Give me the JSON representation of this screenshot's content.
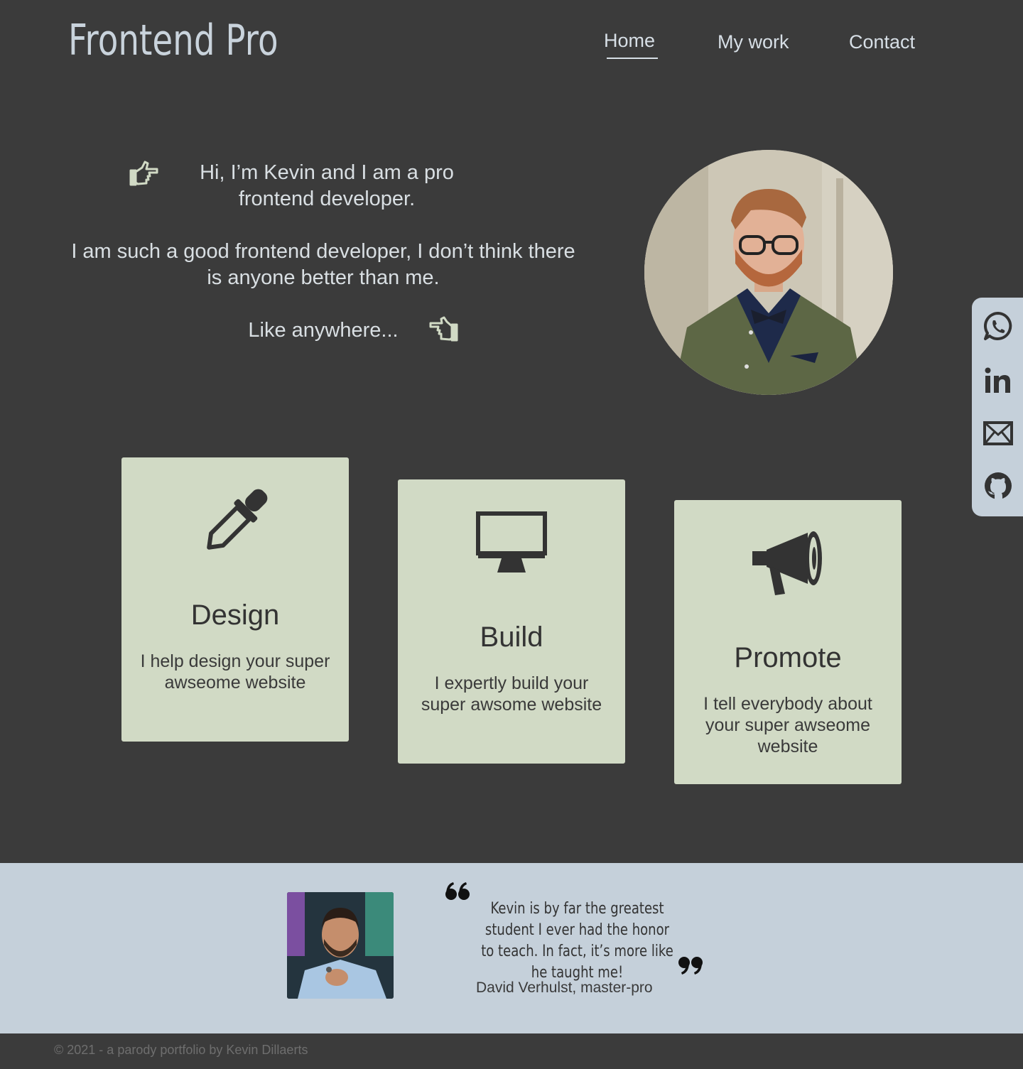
{
  "header": {
    "logo": "Frontend Pro",
    "nav": [
      {
        "label": "Home",
        "active": true
      },
      {
        "label": "My work"
      },
      {
        "label": "Contact"
      }
    ]
  },
  "hero": {
    "line1": "Hi, I’m Kevin and I am a pro frontend developer.",
    "line2": "I am such a good frontend developer, I don’t think there is anyone better than me.",
    "line3": "Like anywhere...",
    "icons": [
      "pointing-right-hand-icon",
      "pointing-left-hand-icon"
    ]
  },
  "services": [
    {
      "title": "Design",
      "description": "I help design your super awseome website",
      "icon": "eyedropper-icon"
    },
    {
      "title": "Build",
      "description": "I expertly build your super awsome website",
      "icon": "monitor-icon"
    },
    {
      "title": "Promote",
      "description": "I tell everybody about your super awseome website",
      "icon": "megaphone-icon"
    }
  ],
  "social": [
    "whatsapp-icon",
    "linkedin-icon",
    "mail-icon",
    "github-icon"
  ],
  "testimonial": {
    "quote": "Kevin is by far the greatest student I ever had the honor to teach. In fact, it’s more like he taught me!",
    "author": "David Verhulst, master-pro"
  },
  "footer": {
    "text": "© 2021 - a parody portfolio by Kevin Dillaerts"
  },
  "colors": {
    "background": "#3b3b3b",
    "card": "#d1dac5",
    "accent_light": "#c5d0da",
    "text_light": "#d9dfe3"
  }
}
